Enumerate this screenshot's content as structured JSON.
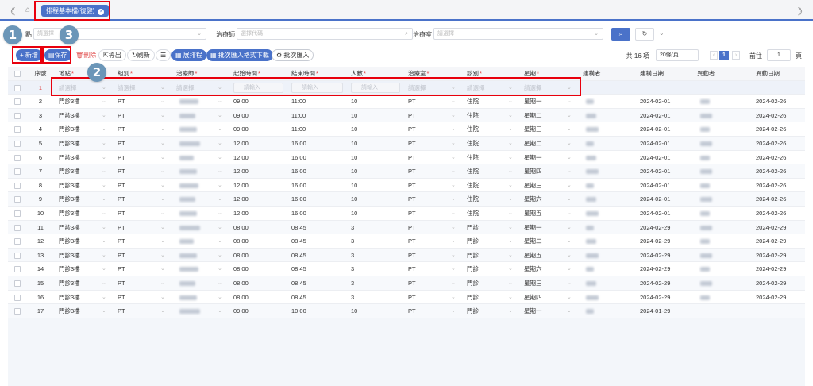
{
  "tabbar": {
    "nav_left": "《",
    "nav_right": "》",
    "home_icon": "home-icon",
    "active_tab": "排程基本檔(復健)",
    "close_icon": "close-icon"
  },
  "filters": {
    "location_label": "點",
    "location_placeholder": "請選擇",
    "therapist_label": "治療師",
    "therapist_placeholder": "選擇代碼",
    "room_label": "治療室",
    "room_placeholder": "請選擇",
    "search_icon": "search-icon",
    "reset_icon": "refresh-icon"
  },
  "toolbar": {
    "add": "+ 新增",
    "save": "保存",
    "delete": "刪除",
    "export": "導出",
    "refresh": "刷新",
    "expand": "展排程",
    "batch_template": "批次匯入格式下載",
    "batch_import": "批次匯入"
  },
  "pager": {
    "total": "共 16 項",
    "page_size": "20條/頁",
    "current_page": "1",
    "goto_label": "前往",
    "goto_value": "1",
    "goto_unit": "頁"
  },
  "columns": [
    {
      "label": "序號",
      "required": false
    },
    {
      "label": "地點",
      "required": true
    },
    {
      "label": "組別",
      "required": true
    },
    {
      "label": "治療師",
      "required": true
    },
    {
      "label": "起始時間",
      "required": true
    },
    {
      "label": "結束時間",
      "required": true
    },
    {
      "label": "人數",
      "required": true
    },
    {
      "label": "治療室",
      "required": true
    },
    {
      "label": "診別",
      "required": true
    },
    {
      "label": "星期",
      "required": true
    },
    {
      "label": "建構者",
      "required": false
    },
    {
      "label": "建構日期",
      "required": false
    },
    {
      "label": "異動者",
      "required": false
    },
    {
      "label": "異動日期",
      "required": false
    }
  ],
  "required_mark": "*",
  "new_row": {
    "no": "1",
    "select_placeholder": "請選擇",
    "input_placeholder": "請輸入"
  },
  "rows": [
    {
      "no": "2",
      "loc": "門診3樓",
      "grp": "PT",
      "start": "09:00",
      "end": "11:00",
      "num": "10",
      "room": "PT",
      "type": "住院",
      "week": "星期一",
      "cdate": "2024-02-01",
      "mdate": "2024-02-26"
    },
    {
      "no": "3",
      "loc": "門診3樓",
      "grp": "PT",
      "start": "09:00",
      "end": "11:00",
      "num": "10",
      "room": "PT",
      "type": "住院",
      "week": "星期二",
      "cdate": "2024-02-01",
      "mdate": "2024-02-26"
    },
    {
      "no": "4",
      "loc": "門診3樓",
      "grp": "PT",
      "start": "09:00",
      "end": "11:00",
      "num": "10",
      "room": "PT",
      "type": "住院",
      "week": "星期三",
      "cdate": "2024-02-01",
      "mdate": "2024-02-26"
    },
    {
      "no": "5",
      "loc": "門診3樓",
      "grp": "PT",
      "start": "12:00",
      "end": "16:00",
      "num": "10",
      "room": "PT",
      "type": "住院",
      "week": "星期二",
      "cdate": "2024-02-01",
      "mdate": "2024-02-26"
    },
    {
      "no": "6",
      "loc": "門診3樓",
      "grp": "PT",
      "start": "12:00",
      "end": "16:00",
      "num": "10",
      "room": "PT",
      "type": "住院",
      "week": "星期一",
      "cdate": "2024-02-01",
      "mdate": "2024-02-26"
    },
    {
      "no": "7",
      "loc": "門診3樓",
      "grp": "PT",
      "start": "12:00",
      "end": "16:00",
      "num": "10",
      "room": "PT",
      "type": "住院",
      "week": "星期四",
      "cdate": "2024-02-01",
      "mdate": "2024-02-26"
    },
    {
      "no": "8",
      "loc": "門診3樓",
      "grp": "PT",
      "start": "12:00",
      "end": "16:00",
      "num": "10",
      "room": "PT",
      "type": "住院",
      "week": "星期三",
      "cdate": "2024-02-01",
      "mdate": "2024-02-26"
    },
    {
      "no": "9",
      "loc": "門診3樓",
      "grp": "PT",
      "start": "12:00",
      "end": "16:00",
      "num": "10",
      "room": "PT",
      "type": "住院",
      "week": "星期六",
      "cdate": "2024-02-01",
      "mdate": "2024-02-26"
    },
    {
      "no": "10",
      "loc": "門診3樓",
      "grp": "PT",
      "start": "12:00",
      "end": "16:00",
      "num": "10",
      "room": "PT",
      "type": "住院",
      "week": "星期五",
      "cdate": "2024-02-01",
      "mdate": "2024-02-26"
    },
    {
      "no": "11",
      "loc": "門診3樓",
      "grp": "PT",
      "start": "08:00",
      "end": "08:45",
      "num": "3",
      "room": "PT",
      "type": "門診",
      "week": "星期一",
      "cdate": "2024-02-29",
      "mdate": "2024-02-29"
    },
    {
      "no": "12",
      "loc": "門診3樓",
      "grp": "PT",
      "start": "08:00",
      "end": "08:45",
      "num": "3",
      "room": "PT",
      "type": "門診",
      "week": "星期二",
      "cdate": "2024-02-29",
      "mdate": "2024-02-29"
    },
    {
      "no": "13",
      "loc": "門診3樓",
      "grp": "PT",
      "start": "08:00",
      "end": "08:45",
      "num": "3",
      "room": "PT",
      "type": "門診",
      "week": "星期五",
      "cdate": "2024-02-29",
      "mdate": "2024-02-29"
    },
    {
      "no": "14",
      "loc": "門診3樓",
      "grp": "PT",
      "start": "08:00",
      "end": "08:45",
      "num": "3",
      "room": "PT",
      "type": "門診",
      "week": "星期六",
      "cdate": "2024-02-29",
      "mdate": "2024-02-29"
    },
    {
      "no": "15",
      "loc": "門診3樓",
      "grp": "PT",
      "start": "08:00",
      "end": "08:45",
      "num": "3",
      "room": "PT",
      "type": "門診",
      "week": "星期三",
      "cdate": "2024-02-29",
      "mdate": "2024-02-29"
    },
    {
      "no": "16",
      "loc": "門診3樓",
      "grp": "PT",
      "start": "08:00",
      "end": "08:45",
      "num": "3",
      "room": "PT",
      "type": "門診",
      "week": "星期四",
      "cdate": "2024-02-29",
      "mdate": "2024-02-29"
    },
    {
      "no": "17",
      "loc": "門診3樓",
      "grp": "PT",
      "start": "09:00",
      "end": "10:00",
      "num": "10",
      "room": "PT",
      "type": "門診",
      "week": "星期一",
      "cdate": "2024-01-29",
      "mdate": ""
    }
  ],
  "annotations": {
    "badge1": "1",
    "badge2": "2",
    "badge3": "3"
  },
  "colors": {
    "accent": "#4a72c9",
    "highlight": "#e8000d",
    "badge": "#6b96b8",
    "danger": "#e04646"
  }
}
